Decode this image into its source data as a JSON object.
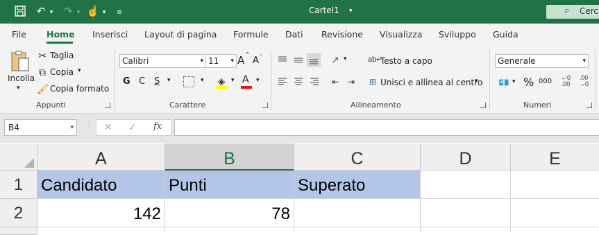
{
  "title_bar": {
    "title": "Cartel1",
    "search_label": "Cerca"
  },
  "tabs": [
    "File",
    "Home",
    "Inserisci",
    "Layout di pagina",
    "Formule",
    "Dati",
    "Revisione",
    "Visualizza",
    "Sviluppo",
    "Guida"
  ],
  "active_tab": "Home",
  "ribbon": {
    "clipboard": {
      "paste": "Incolla",
      "cut": "Taglia",
      "copy": "Copia",
      "format_painter": "Copia formato",
      "group": "Appunti"
    },
    "font": {
      "name": "Calibri",
      "size": "11",
      "grow": "A",
      "shrink": "A",
      "bold": "G",
      "italic": "C",
      "underline": "S",
      "font_color": "A",
      "group": "Carattere"
    },
    "alignment": {
      "wrap_text": "Testo a capo",
      "merge_center": "Unisci e allinea al centro",
      "group": "Allineamento"
    },
    "number": {
      "format": "Generale",
      "percent": "%",
      "comma": "000",
      "group": "Numeri"
    }
  },
  "formula_bar": {
    "name_box": "B4",
    "fx": "fx",
    "formula": ""
  },
  "sheet": {
    "columns": [
      "A",
      "B",
      "C",
      "D",
      "E"
    ],
    "selected_column": "B",
    "rows": [
      {
        "num": "1",
        "cells": [
          "Candidato",
          "Punti",
          "Superato",
          "",
          ""
        ]
      },
      {
        "num": "2",
        "cells": [
          "142",
          "78",
          "",
          "",
          ""
        ]
      }
    ]
  }
}
